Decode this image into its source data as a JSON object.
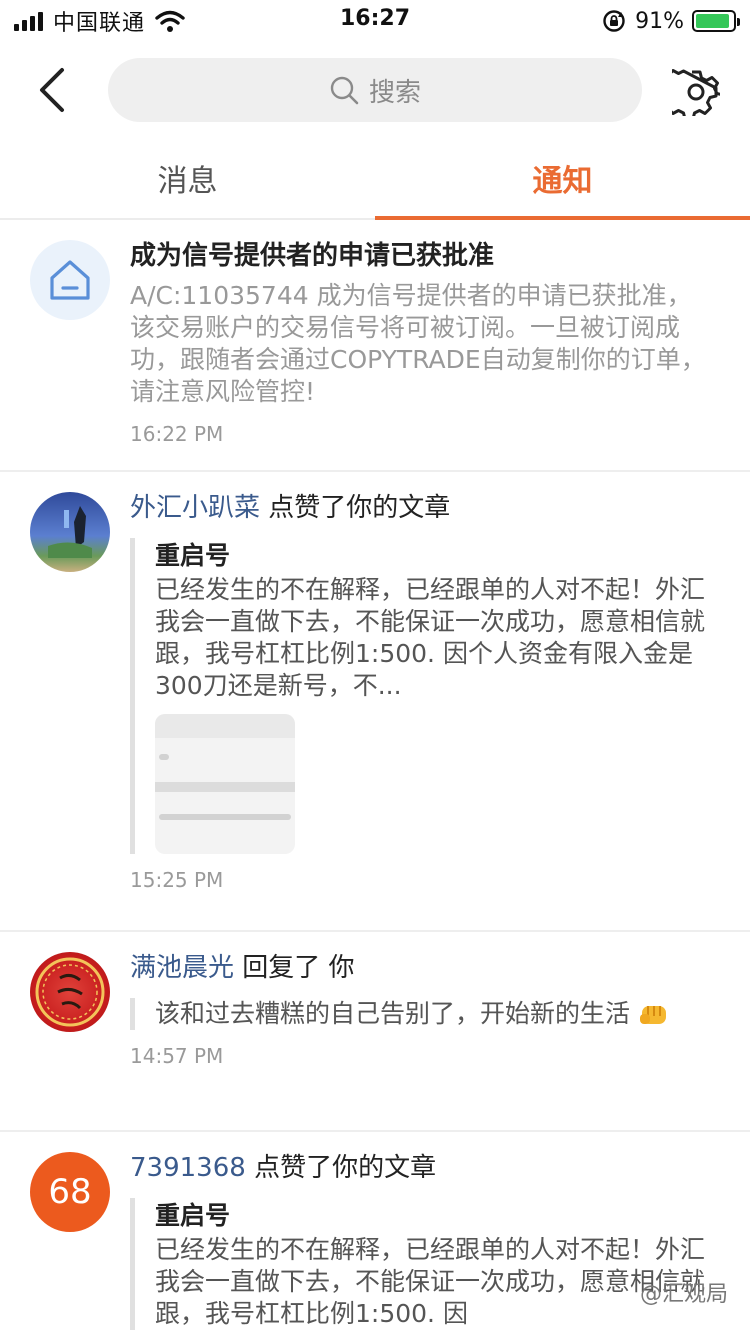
{
  "status_bar": {
    "carrier": "中国联通",
    "time": "16:27",
    "battery": "91%",
    "battery_level": 0.91
  },
  "nav": {
    "search_placeholder": "搜索"
  },
  "tabs": {
    "messages": "消息",
    "notifications": "通知"
  },
  "items": [
    {
      "title": "成为信号提供者的申请已获批准",
      "desc": "A/C:11035744 成为信号提供者的申请已获批准，该交易账户的交易信号将可被订阅。一旦被订阅成功，跟随者会通过COPYTRADE自动复制你的订单，请注意风险管控!",
      "time": "16:22 PM"
    },
    {
      "user": "外汇小趴菜",
      "action": "点赞了你的文章",
      "quote_title": "重启号",
      "quote_text": "已经发生的不在解释，已经跟单的人对不起！外汇我会一直做下去，不能保证一次成功，愿意相信就跟，我号杠杠比例1:500. 因个人资金有限入金是300刀还是新号，不...",
      "time": "15:25 PM"
    },
    {
      "user": "满池晨光",
      "action": "回复了 你",
      "quote_text": "该和过去糟糕的自己告别了，开始新的生活",
      "time": "14:57 PM"
    },
    {
      "avatar_text": "68",
      "user": "7391368",
      "action": "点赞了你的文章",
      "quote_title": "重启号",
      "quote_text": "已经发生的不在解释，已经跟单的人对不起！外汇我会一直做下去，不能保证一次成功，愿意相信就跟，我号杠杠比例1:500. 因"
    }
  ],
  "watermark": "@汇观局",
  "colors": {
    "accent": "#ea6b32",
    "username": "#3a5a8c"
  }
}
